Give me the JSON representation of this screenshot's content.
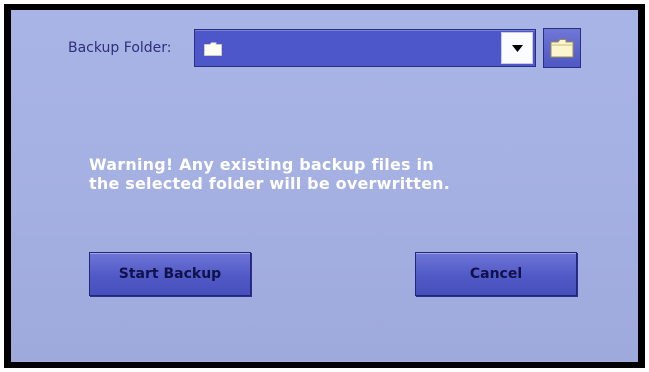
{
  "backup_folder": {
    "label": "Backup Folder:",
    "value": "",
    "combo_icon": "folder-icon",
    "dropdown_icon": "chevron-down-icon",
    "browse_icon": "folder-icon"
  },
  "warning": {
    "line1": "Warning!  Any existing backup files in",
    "line2": "the selected folder will be overwritten."
  },
  "buttons": {
    "start_label": "Start Backup",
    "cancel_label": "Cancel"
  },
  "colors": {
    "panel_background": "#a8b3e5",
    "combo_fill": "#4e57c9",
    "button_fill": "#5b63cc",
    "warning_text": "#ffffff"
  }
}
